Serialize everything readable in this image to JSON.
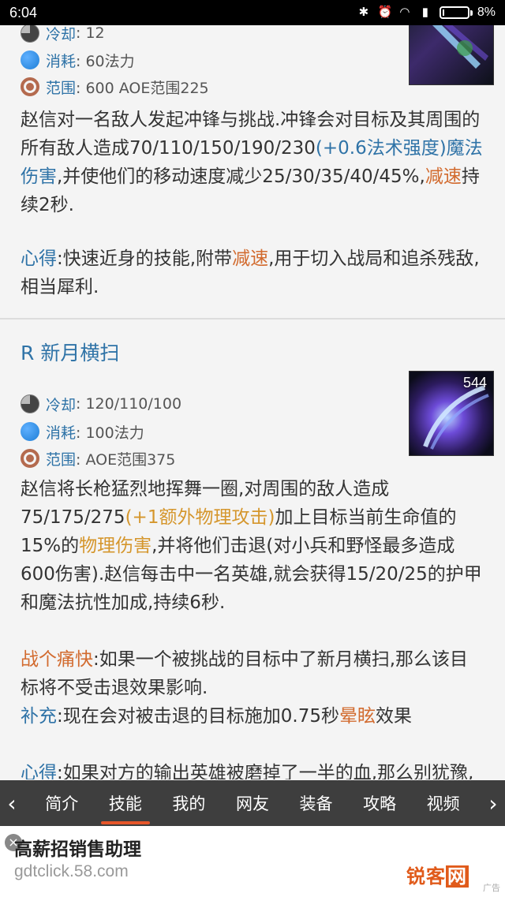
{
  "status_bar": {
    "time": "6:04",
    "battery": "8%",
    "battery_level": 0.08
  },
  "skill_e": {
    "cooldown_label": "冷却",
    "cooldown_value": ": 12",
    "cost_label": "消耗",
    "cost_value": ": 60法力",
    "range_label": "范围",
    "range_value": ": 600 AOE范围225",
    "desc_1": "赵信对一名敌人发起冲锋与挑战.冲锋会对目标及其周围的所有敌人造成70/110/150/190/230",
    "desc_2": "(+0.6法术强度)",
    "desc_3": "魔法伤害",
    "desc_4": ",并使他们的移动速度减少25/30/35/40/45%,",
    "desc_5": "减速",
    "desc_6": "持续2秒.",
    "tip_label": "心得",
    "tip_1": ":快速近身的技能,附带",
    "tip_2": "减速",
    "tip_3": ",用于切入战局和追杀残敌,相当犀利."
  },
  "skill_r": {
    "title": "R 新月横扫",
    "thumb_number": "544",
    "cooldown_label": "冷却",
    "cooldown_value": ": 120/110/100",
    "cost_label": "消耗",
    "cost_value": ": 100法力",
    "range_label": "范围",
    "range_value": ": AOE范围375",
    "desc_1": "赵信将长枪猛烈地挥舞一圈,对周围的敌人造成75/175/275",
    "desc_2": "(+1额外物理攻击)",
    "desc_3": "加上目标当前生命值的15%的",
    "desc_4": "物理伤害",
    "desc_5": ",并将他们击退(对小兵和野怪最多造成600伤害).赵信每击中一名英雄,就会获得15/20/25的护甲和魔法抗性加成,持续6秒.",
    "note1_label": "战个痛快",
    "note1_text": ":如果一个被挑战的目标中了新月横扫,那么该目标将不受击退效果影响.",
    "note2_label": "补充",
    "note2_text_1": ":现在会对被击退的目标施加0.75秒",
    "note2_text_2": "晕眩",
    "note2_text_3": "效果",
    "tip_label": "心得",
    "tip_text": ":如果对方的输出英雄被磨掉了一半的血,那么别犹豫,开了技能上去收人头吧."
  },
  "tabs": [
    "简介",
    "技能",
    "我的",
    "网友",
    "装备",
    "攻略",
    "视频"
  ],
  "active_tab": "技能",
  "ad": {
    "title": "高薪招销售助理",
    "url": "gdtclick.58.com",
    "logo_a": "锐客",
    "logo_b": "网",
    "mark": "广告"
  },
  "colors": {
    "accent_blue": "#2f73a7",
    "orange": "#d26b2f",
    "gold": "#d5962c",
    "tab_active": "#e6562a"
  }
}
